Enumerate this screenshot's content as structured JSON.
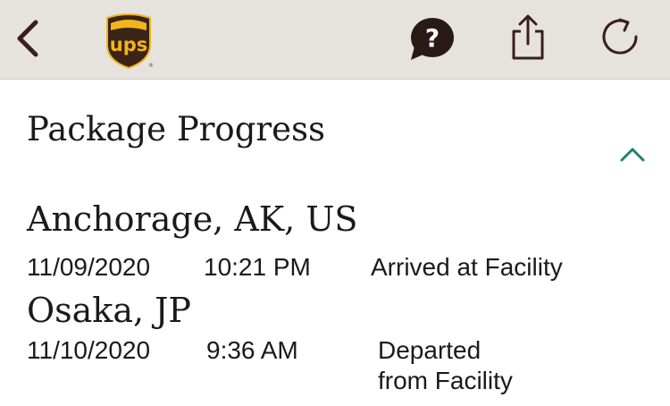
{
  "toolbar": {
    "back_icon": "chevron-left-icon",
    "logo_text": "ups",
    "help_icon": "question-bubble-icon",
    "share_icon": "share-icon",
    "refresh_icon": "refresh-icon",
    "background_color": "#e6e3df",
    "icon_color": "#3b1f1a",
    "logo_shield_color": "#3a2418",
    "logo_gold_color": "#f3b41a"
  },
  "section": {
    "title": "Package Progress",
    "collapse_icon": "chevron-up-icon",
    "collapse_icon_color": "#1f7f76"
  },
  "events": [
    {
      "location": "Anchorage, AK, US",
      "date": "11/09/2020",
      "time": "10:21 PM",
      "status_line1": "Arrived at Facility",
      "status_line2": ""
    },
    {
      "location": "Osaka, JP",
      "date": "11/10/2020",
      "time": "9:36 AM",
      "status_line1": "Departed",
      "status_line2": "from Facility"
    }
  ]
}
